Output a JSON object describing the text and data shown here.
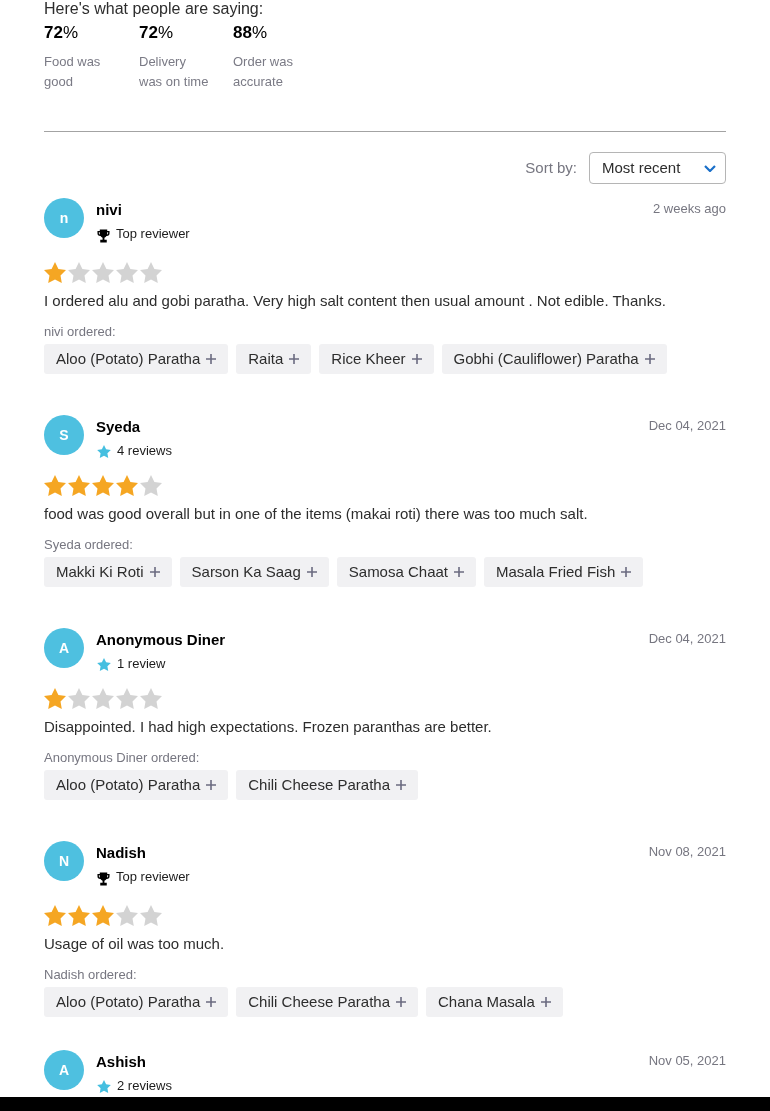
{
  "header": {
    "heading": "Here's what people are saying:"
  },
  "stats": [
    {
      "value": "**72**%",
      "label": "Food was good"
    },
    {
      "value": "**72**%",
      "label": "Delivery was on time"
    },
    {
      "value": "**88**%",
      "label": "Order was accurate"
    }
  ],
  "sort": {
    "label": "Sort by:",
    "value": "Most recent"
  },
  "reviews": [
    {
      "initial": "n",
      "name": "nivi",
      "badge": {
        "kind": "top_reviewer",
        "text": "Top reviewer"
      },
      "date": "2 weeks ago",
      "stars": 1,
      "text": "I ordered alu and gobi paratha. Very high salt content then usual amount . Not edible. Thanks.",
      "ordered_label": "nivi ordered:",
      "items": [
        "Aloo (Potato) Paratha",
        "Raita",
        "Rice Kheer",
        "Gobhi (Cauliflower) Paratha"
      ]
    },
    {
      "initial": "S",
      "name": "Syeda",
      "badge": {
        "kind": "review_count",
        "text": "4 reviews"
      },
      "date": "Dec 04, 2021",
      "stars": 4,
      "text": "food was good overall but in one of the items (makai roti) there was too much salt.",
      "ordered_label": "Syeda ordered:",
      "items": [
        "Makki Ki Roti",
        "Sarson Ka Saag",
        "Samosa Chaat",
        "Masala Fried Fish"
      ]
    },
    {
      "initial": "A",
      "name": "Anonymous Diner",
      "badge": {
        "kind": "review_count",
        "text": "1 review"
      },
      "date": "Dec 04, 2021",
      "stars": 1,
      "text": "Disappointed. I had high expectations. Frozen paranthas are better.",
      "ordered_label": "Anonymous Diner ordered:",
      "items": [
        "Aloo (Potato) Paratha",
        "Chili Cheese Paratha"
      ]
    },
    {
      "initial": "N",
      "name": "Nadish",
      "badge": {
        "kind": "top_reviewer",
        "text": "Top reviewer"
      },
      "date": "Nov 08, 2021",
      "stars": 3,
      "text": "Usage of oil was too much.",
      "ordered_label": "Nadish ordered:",
      "items": [
        "Aloo (Potato) Paratha",
        "Chili Cheese Paratha",
        "Chana Masala"
      ]
    },
    {
      "initial": "A",
      "name": "Ashish",
      "badge": {
        "kind": "review_count",
        "text": "2 reviews"
      },
      "date": "Nov 05, 2021"
    }
  ]
}
